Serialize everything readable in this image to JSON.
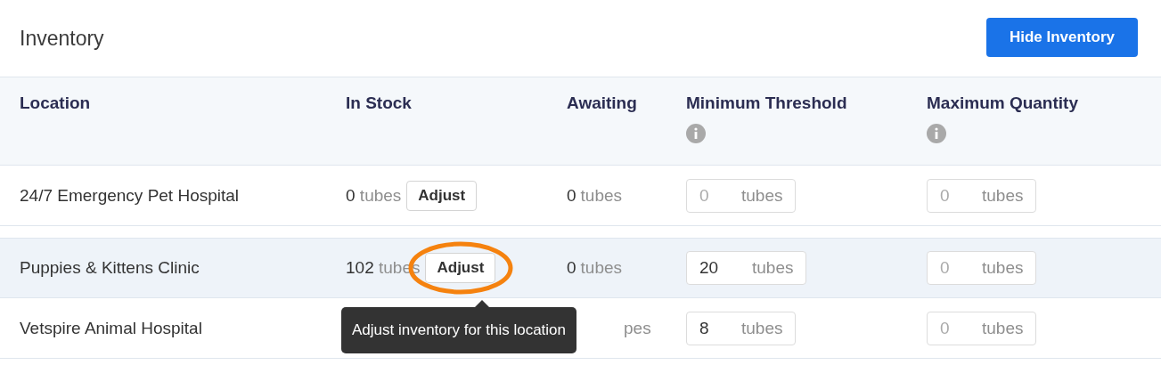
{
  "title": "Inventory",
  "hide_button": "Hide Inventory",
  "columns": [
    {
      "label": "Location"
    },
    {
      "label": "In Stock"
    },
    {
      "label": "Awaiting"
    },
    {
      "label": "Minimum Threshold",
      "info": true
    },
    {
      "label": "Maximum Quantity",
      "info": true
    }
  ],
  "rows": [
    {
      "location": "24/7 Emergency Pet Hospital",
      "highlighted": false,
      "in_stock": {
        "count": "0",
        "unit": "tubes"
      },
      "adjust": "Adjust",
      "circled": false,
      "awaiting": {
        "count": "0",
        "unit": "tubes"
      },
      "minimum": {
        "placeholder": "0",
        "unit": "tubes"
      },
      "maximum": {
        "placeholder": "0",
        "unit": "tubes"
      }
    },
    {
      "location": "Puppies & Kittens Clinic",
      "highlighted": true,
      "in_stock": {
        "count": "102",
        "unit": "tubes"
      },
      "adjust": "Adjust",
      "circled": true,
      "awaiting": {
        "count": "0",
        "unit": "tubes"
      },
      "minimum": {
        "value": "20",
        "unit": "tubes"
      },
      "maximum": {
        "placeholder": "0",
        "unit": "tubes"
      }
    },
    {
      "location": "Vetspire Animal Hospital",
      "highlighted": false,
      "awaiting": {
        "unit": "pes"
      },
      "minimum": {
        "value": "8",
        "unit": "tubes"
      },
      "maximum": {
        "placeholder": "0",
        "unit": "tubes"
      }
    }
  ],
  "tooltip": "Adjust inventory for this location"
}
